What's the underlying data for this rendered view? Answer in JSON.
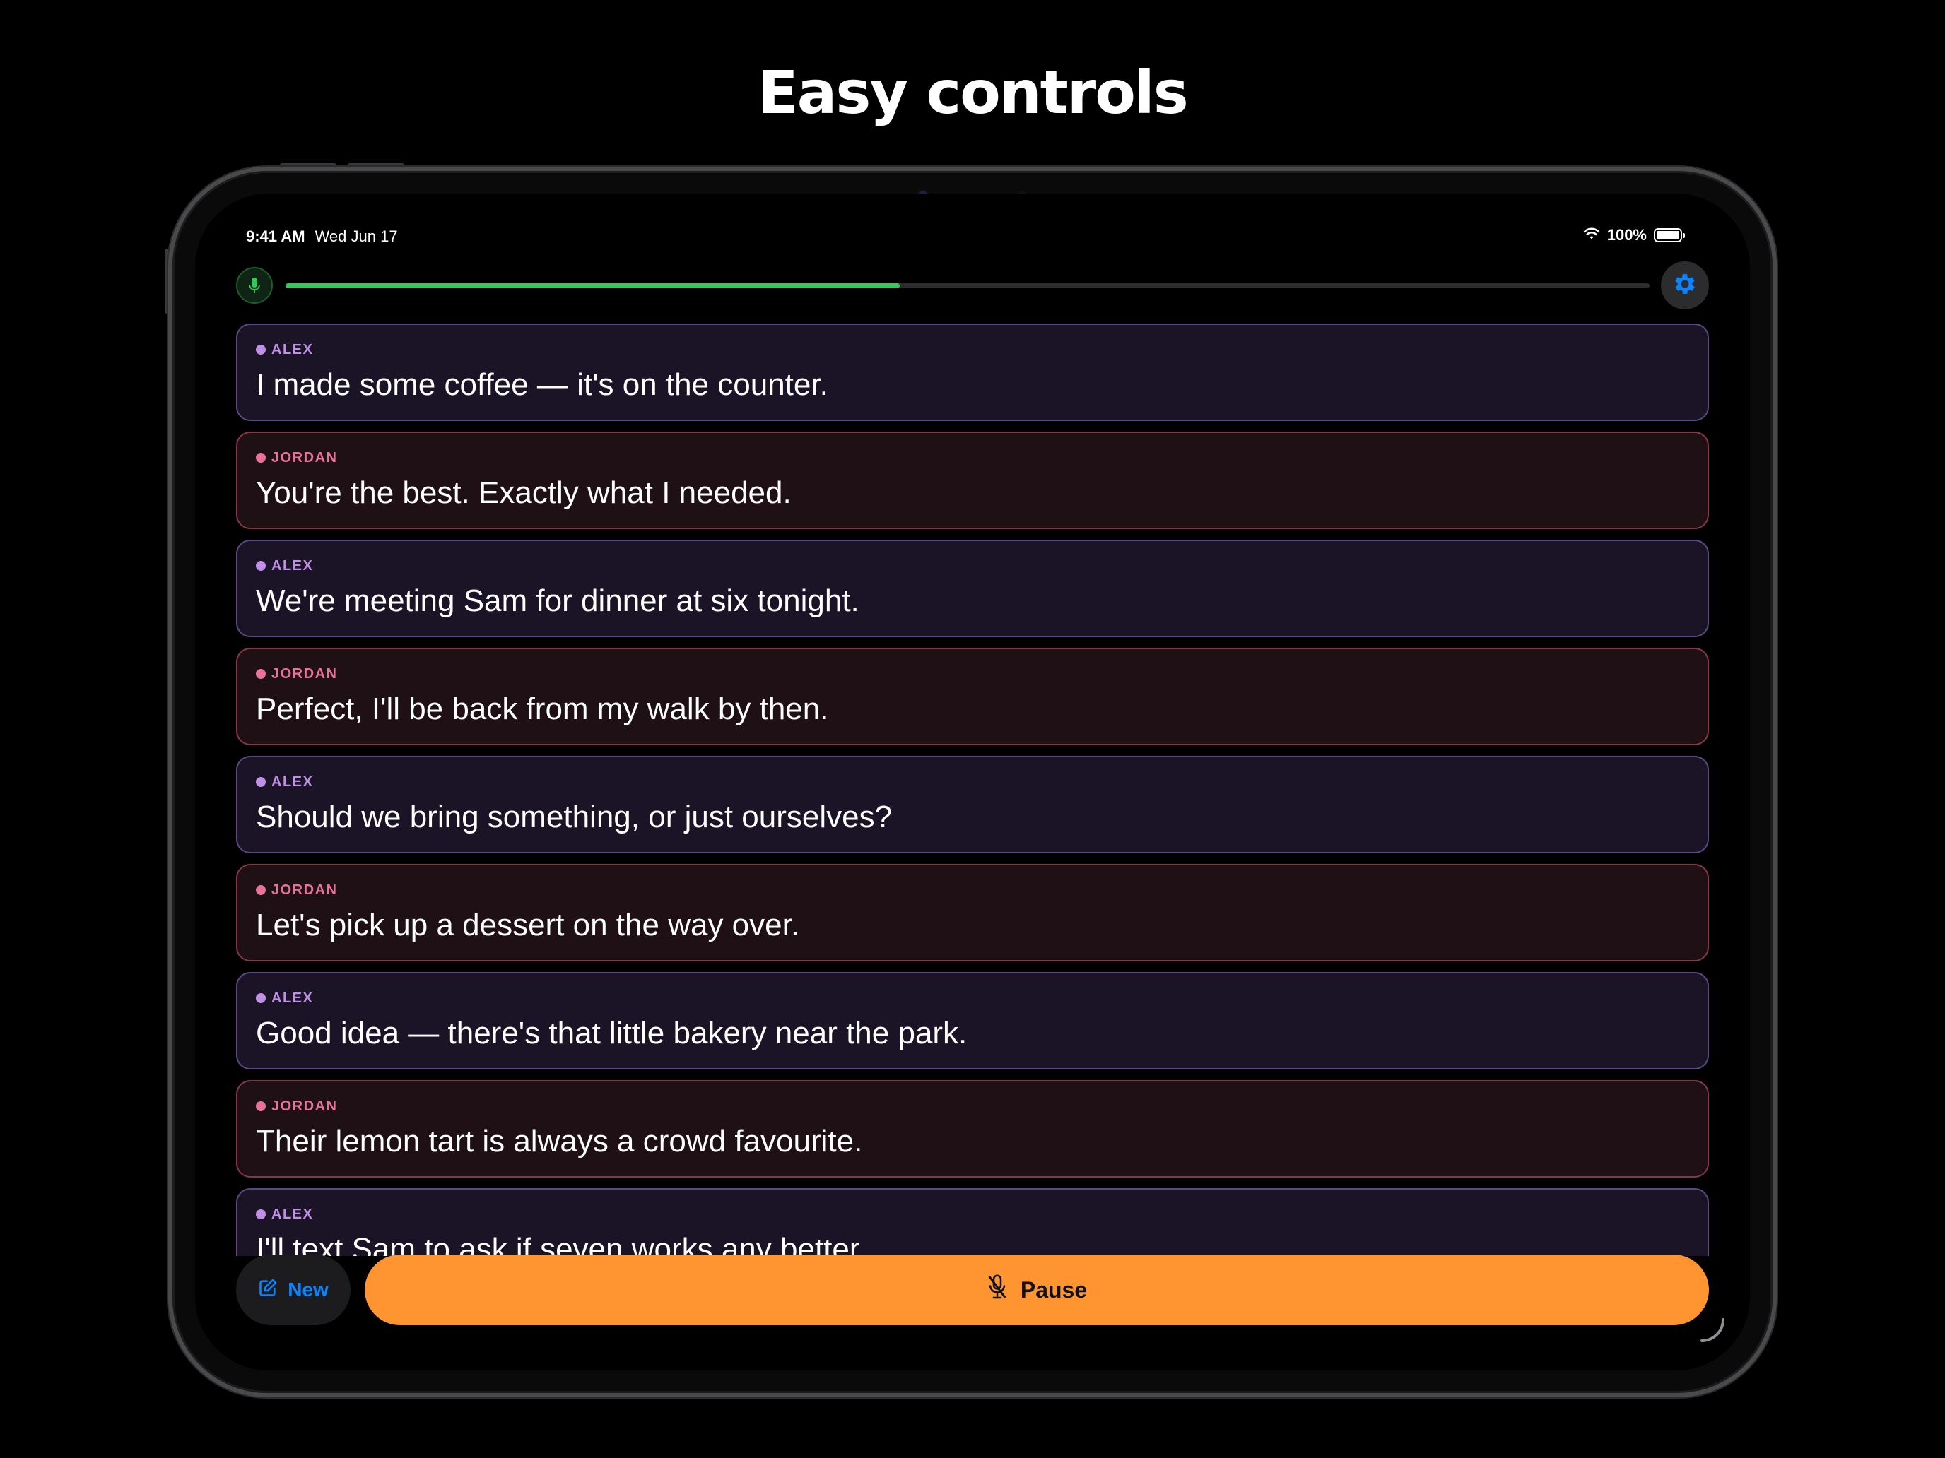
{
  "headline": "Easy controls",
  "status_bar": {
    "time": "9:41 AM",
    "date": "Wed Jun 17",
    "battery": "100%",
    "icons": [
      "wifi-icon",
      "battery-icon"
    ]
  },
  "top_bar": {
    "mic_icon": "microphone-icon",
    "progress": 0.45,
    "settings_icon": "gear-icon"
  },
  "colors": {
    "accent_green": "#34c759",
    "accent_blue": "#0a84ff",
    "pause_orange": "#ff9530",
    "alex_purple": "#c18ee8",
    "jordan_pink": "#e8729a"
  },
  "transcript": [
    {
      "speaker": "ALEX",
      "text": "I made some coffee — it's on the counter."
    },
    {
      "speaker": "JORDAN",
      "text": "You're the best. Exactly what I needed."
    },
    {
      "speaker": "ALEX",
      "text": "We're meeting Sam for dinner at six tonight."
    },
    {
      "speaker": "JORDAN",
      "text": "Perfect, I'll be back from my walk by then."
    },
    {
      "speaker": "ALEX",
      "text": "Should we bring something, or just ourselves?"
    },
    {
      "speaker": "JORDAN",
      "text": "Let's pick up a dessert on the way over."
    },
    {
      "speaker": "ALEX",
      "text": "Good idea — there's that little bakery near the park."
    },
    {
      "speaker": "JORDAN",
      "text": "Their lemon tart is always a crowd favourite."
    },
    {
      "speaker": "ALEX",
      "text": "I'll text Sam to ask if seven works any better."
    }
  ],
  "controls": {
    "new_label": "New",
    "new_icon": "compose-icon",
    "pause_label": "Pause",
    "pause_icon": "mic-slash-icon"
  }
}
